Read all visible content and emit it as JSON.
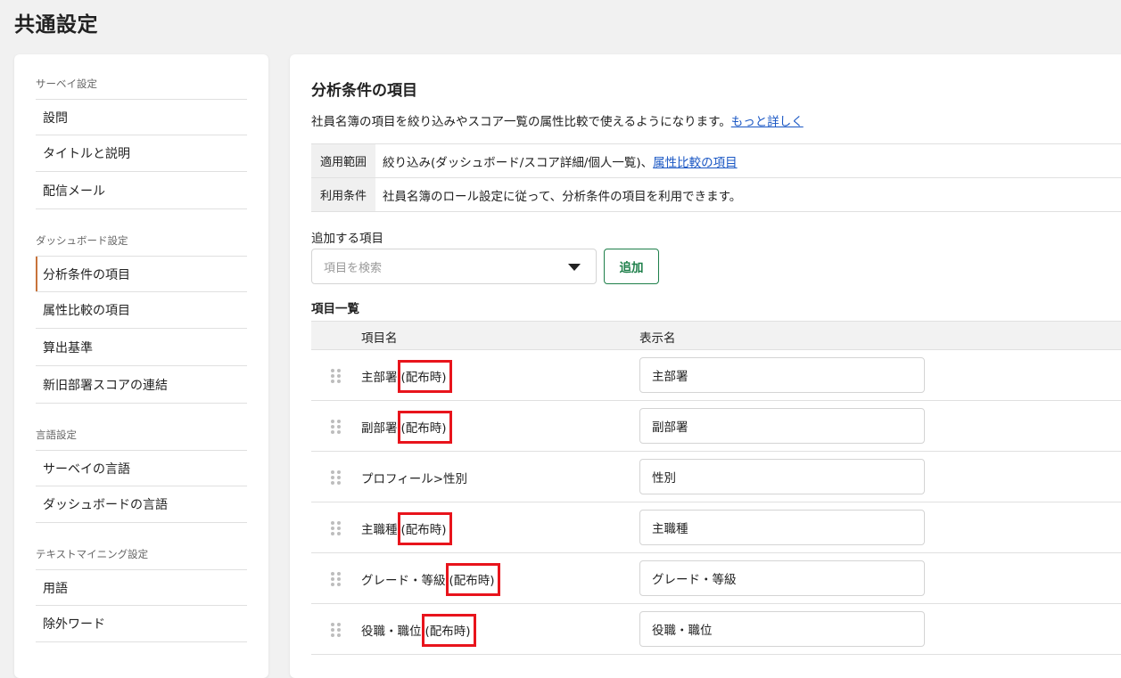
{
  "page_title": "共通設定",
  "sidebar": {
    "sections": [
      {
        "title": "サーベイ設定",
        "items": [
          "設問",
          "タイトルと説明",
          "配信メール"
        ]
      },
      {
        "title": "ダッシュボード設定",
        "items": [
          "分析条件の項目",
          "属性比較の項目",
          "算出基準",
          "新旧部署スコアの連結"
        ]
      },
      {
        "title": "言語設定",
        "items": [
          "サーベイの言語",
          "ダッシュボードの言語"
        ]
      },
      {
        "title": "テキストマイニング設定",
        "items": [
          "用語",
          "除外ワード"
        ]
      }
    ],
    "active_item": "分析条件の項目",
    "active_color": "#c8733a"
  },
  "main": {
    "title": "分析条件の項目",
    "description": "社員名簿の項目を絞り込みやスコア一覧の属性比較で使えるようになります。",
    "description_link": "もっと詳しく",
    "info": [
      {
        "key": "適用範囲",
        "value": "絞り込み(ダッシュボード/スコア詳細/個人一覧)、",
        "link": "属性比較の項目"
      },
      {
        "key": "利用条件",
        "value": "社員名簿のロール設定に従って、分析条件の項目を利用できます。",
        "link": ""
      }
    ],
    "add_label": "追加する項目",
    "search_placeholder": "項目を検索",
    "add_button": "追加",
    "list_title": "項目一覧",
    "columns": {
      "name": "項目名",
      "display": "表示名"
    },
    "rows": [
      {
        "name": "主部署",
        "suffix": "(配布時)",
        "display": "主部署"
      },
      {
        "name": "副部署",
        "suffix": "(配布時)",
        "display": "副部署"
      },
      {
        "name": "プロフィール>性別",
        "suffix": "",
        "display": "性別"
      },
      {
        "name": "主職種",
        "suffix": "(配布時)",
        "display": "主職種"
      },
      {
        "name": "グレード・等級",
        "suffix": "(配布時)",
        "display": "グレード・等級"
      },
      {
        "name": "役職・職位",
        "suffix": "(配布時)",
        "display": "役職・職位"
      }
    ],
    "highlight_color": "#e8141c",
    "link_color": "#1a57c4",
    "button_color": "#1e7f4a"
  }
}
